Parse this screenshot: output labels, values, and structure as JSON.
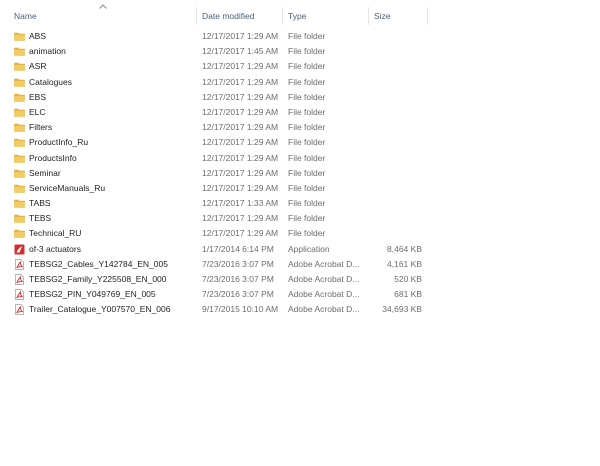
{
  "columns": {
    "name": "Name",
    "date": "Date modified",
    "type": "Type",
    "size": "Size"
  },
  "sort": {
    "column": "name",
    "indicator": "chevron-up-icon"
  },
  "colors": {
    "folder": "#e8b84a",
    "folder_dark": "#d9a534",
    "pdf_red": "#d32f2f",
    "header_text": "#4c607a"
  },
  "files": [
    {
      "name": "ABS",
      "date": "12/17/2017 1:29 AM",
      "type": "File folder",
      "size": "",
      "icon": "folder-icon"
    },
    {
      "name": "animation",
      "date": "12/17/2017 1:45 AM",
      "type": "File folder",
      "size": "",
      "icon": "folder-icon"
    },
    {
      "name": "ASR",
      "date": "12/17/2017 1:29 AM",
      "type": "File folder",
      "size": "",
      "icon": "folder-icon"
    },
    {
      "name": "Catalogues",
      "date": "12/17/2017 1:29 AM",
      "type": "File folder",
      "size": "",
      "icon": "folder-icon"
    },
    {
      "name": "EBS",
      "date": "12/17/2017 1:29 AM",
      "type": "File folder",
      "size": "",
      "icon": "folder-icon"
    },
    {
      "name": "ELC",
      "date": "12/17/2017 1:29 AM",
      "type": "File folder",
      "size": "",
      "icon": "folder-icon"
    },
    {
      "name": "Filters",
      "date": "12/17/2017 1:29 AM",
      "type": "File folder",
      "size": "",
      "icon": "folder-icon"
    },
    {
      "name": "ProductInfo_Ru",
      "date": "12/17/2017 1:29 AM",
      "type": "File folder",
      "size": "",
      "icon": "folder-icon"
    },
    {
      "name": "ProductsInfo",
      "date": "12/17/2017 1:29 AM",
      "type": "File folder",
      "size": "",
      "icon": "folder-icon"
    },
    {
      "name": "Seminar",
      "date": "12/17/2017 1:29 AM",
      "type": "File folder",
      "size": "",
      "icon": "folder-icon"
    },
    {
      "name": "ServiceManuals_Ru",
      "date": "12/17/2017 1:29 AM",
      "type": "File folder",
      "size": "",
      "icon": "folder-icon"
    },
    {
      "name": "TABS",
      "date": "12/17/2017 1:33 AM",
      "type": "File folder",
      "size": "",
      "icon": "folder-icon"
    },
    {
      "name": "TEBS",
      "date": "12/17/2017 1:29 AM",
      "type": "File folder",
      "size": "",
      "icon": "folder-icon"
    },
    {
      "name": "Technical_RU",
      "date": "12/17/2017 1:29 AM",
      "type": "File folder",
      "size": "",
      "icon": "folder-icon"
    },
    {
      "name": "of-3 actuators",
      "date": "1/17/2014 6:14 PM",
      "type": "Application",
      "size": "8,464 KB",
      "icon": "application-icon"
    },
    {
      "name": "TEBSG2_Cables_Y142784_EN_005",
      "date": "7/23/2016 3:07 PM",
      "type": "Adobe Acrobat D...",
      "size": "4,161 KB",
      "icon": "pdf-icon"
    },
    {
      "name": "TEBSG2_Family_Y225508_EN_000",
      "date": "7/23/2016 3:07 PM",
      "type": "Adobe Acrobat D...",
      "size": "520 KB",
      "icon": "pdf-icon"
    },
    {
      "name": "TEBSG2_PIN_Y049769_EN_005",
      "date": "7/23/2016 3:07 PM",
      "type": "Adobe Acrobat D...",
      "size": "681 KB",
      "icon": "pdf-icon"
    },
    {
      "name": "Trailer_Catalogue_Y007570_EN_006",
      "date": "9/17/2015 10:10 AM",
      "type": "Adobe Acrobat D...",
      "size": "34,693 KB",
      "icon": "pdf-icon"
    }
  ]
}
